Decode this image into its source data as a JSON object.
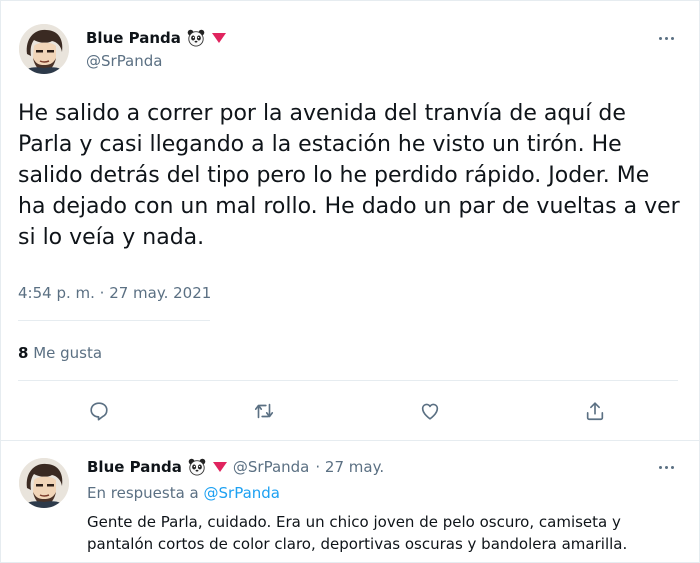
{
  "main_tweet": {
    "author": {
      "display_name": "Blue Panda",
      "handle": "@SrPanda"
    },
    "text": "He salido a correr por la avenida del tranvía de aquí de Parla y casi llegando a la estación he visto un tirón. He salido detrás del tipo pero lo he perdido rápido. Joder. Me ha dejado con un mal rollo. He dado un par de vueltas a ver si lo veía y nada.",
    "timestamp": "4:54 p. m. · 27 may. 2021",
    "likes": {
      "count": "8",
      "label": " Me gusta"
    },
    "actions": [
      {
        "icon": "reply-icon"
      },
      {
        "icon": "retweet-icon"
      },
      {
        "icon": "like-icon"
      },
      {
        "icon": "share-icon"
      }
    ]
  },
  "reply_tweet": {
    "author": {
      "display_name": "Blue Panda",
      "handle": "@SrPanda",
      "date": "· 27 may."
    },
    "in_reply_to_label": "En respuesta a ",
    "in_reply_to_handle": "@SrPanda",
    "text": "Gente de Parla, cuidado. Era un chico joven de pelo oscuro, camiseta y pantalón cortos de color claro, deportivas oscuras y bandolera amarilla."
  },
  "colors": {
    "text": "#0f1419",
    "secondary": "#5b7083",
    "link": "#1da1f2",
    "badge": "#e0245e",
    "divider": "#e6ecf0"
  }
}
